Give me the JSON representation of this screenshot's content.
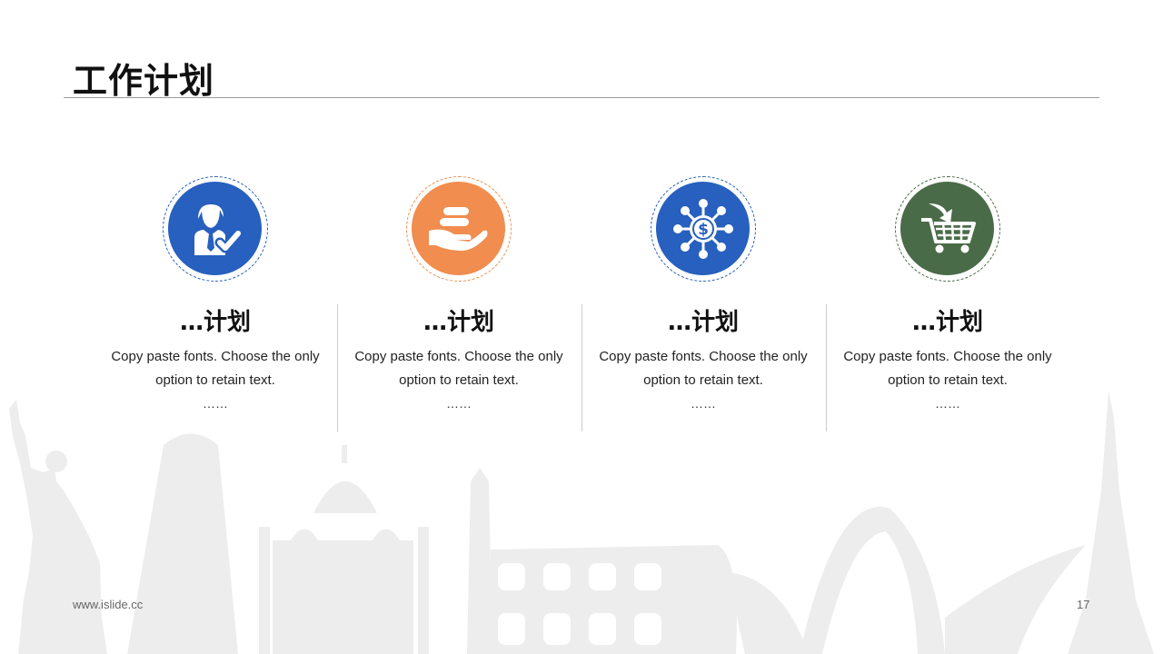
{
  "slide": {
    "title": "工作计划",
    "footer_url": "www.islide.cc",
    "page_number": "17"
  },
  "colors": {
    "blue": "#2760BE",
    "orange": "#F08D4F",
    "green": "#4A6B48",
    "skyline": "#EDEDED"
  },
  "items": [
    {
      "icon": "user-check-icon",
      "heading": "…计划",
      "desc_line1": "Copy paste fonts. Choose the only",
      "desc_line2": "option to retain text.",
      "ellipsis": "……"
    },
    {
      "icon": "hand-coins-icon",
      "heading": "…计划",
      "desc_line1": "Copy paste fonts. Choose the only",
      "desc_line2": "option to retain text.",
      "ellipsis": "……"
    },
    {
      "icon": "dollar-network-icon",
      "heading": "…计划",
      "desc_line1": "Copy paste fonts. Choose the only",
      "desc_line2": "option to retain text.",
      "ellipsis": "……"
    },
    {
      "icon": "shopping-cart-icon",
      "heading": "…计划",
      "desc_line1": "Copy paste fonts. Choose the only",
      "desc_line2": "option to retain text.",
      "ellipsis": "……"
    }
  ]
}
